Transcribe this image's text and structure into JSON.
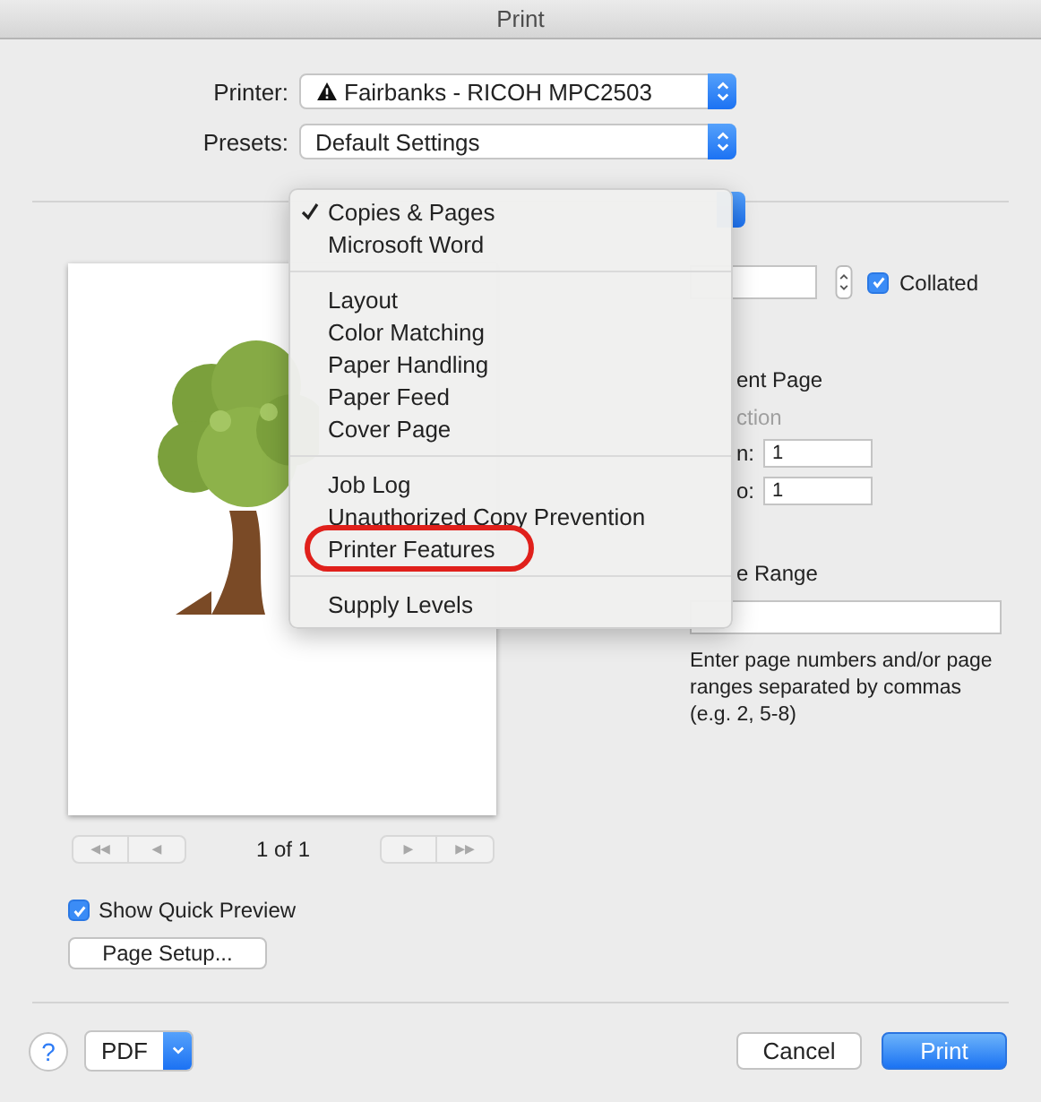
{
  "window": {
    "title": "Print"
  },
  "printer": {
    "label": "Printer:",
    "value": "Fairbanks - RICOH MPC2503",
    "warning": true
  },
  "presets": {
    "label": "Presets:",
    "value": "Default Settings"
  },
  "menu": {
    "groups": [
      [
        {
          "label": "Copies & Pages",
          "checked": true,
          "circled": false
        },
        {
          "label": "Microsoft Word",
          "checked": false,
          "circled": false
        }
      ],
      [
        {
          "label": "Layout",
          "checked": false,
          "circled": false
        },
        {
          "label": "Color Matching",
          "checked": false,
          "circled": false
        },
        {
          "label": "Paper Handling",
          "checked": false,
          "circled": false
        },
        {
          "label": "Paper Feed",
          "checked": false,
          "circled": false
        },
        {
          "label": "Cover Page",
          "checked": false,
          "circled": false
        }
      ],
      [
        {
          "label": "Job Log",
          "checked": false,
          "circled": false
        },
        {
          "label": "Unauthorized Copy Prevention",
          "checked": false,
          "circled": false
        },
        {
          "label": "Printer Features",
          "checked": false,
          "circled": true
        }
      ],
      [
        {
          "label": "Supply Levels",
          "checked": false,
          "circled": false
        }
      ]
    ]
  },
  "preview": {
    "picture": {
      "kind": "picture"
    },
    "nav_buttons": [
      "◀◀",
      "◀",
      "▶",
      "▶▶"
    ],
    "page_indicator": "1 of 1"
  },
  "show_quick_preview": {
    "label": "Show Quick Preview",
    "checked": true
  },
  "page_setup_button": "Page Setup...",
  "copies": {
    "collated": {
      "label": "Collated",
      "checked": true
    }
  },
  "pages": {
    "current_page": "ent Page",
    "selection": {
      "label": "ction",
      "disabled": true
    },
    "from": {
      "label": "n:",
      "value": "1"
    },
    "to": {
      "label": "o:",
      "value": "1"
    },
    "range": {
      "label": "e Range"
    },
    "hint": "Enter page numbers and/or page ranges separated by commas (e.g. 2, 5-8)"
  },
  "footer": {
    "help": "?",
    "pdf": "PDF",
    "cancel": "Cancel",
    "print": "Print"
  }
}
